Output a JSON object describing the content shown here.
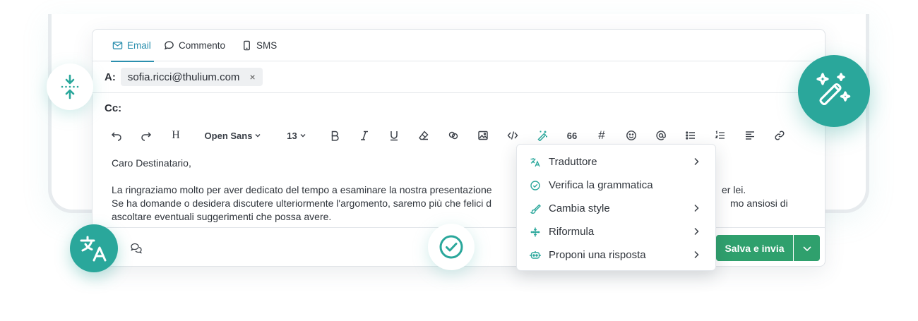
{
  "tabs": [
    {
      "label": "Email",
      "icon": "mail-icon",
      "active": true
    },
    {
      "label": "Commento",
      "icon": "comment-icon",
      "active": false
    },
    {
      "label": "SMS",
      "icon": "phone-icon",
      "active": false
    }
  ],
  "to": {
    "label": "A:",
    "recipient": "sofia.ricci@thulium.com",
    "remove": "×"
  },
  "cc": {
    "label": "Cc:"
  },
  "toolbar": {
    "font_family": "Open Sans",
    "font_size": "13",
    "heading": "H",
    "quote": "66",
    "hash": "#"
  },
  "message": {
    "greeting": "Caro Destinatario,",
    "line1_start": "La ringraziamo molto per aver dedicato del tempo a esaminare la nostra presentazione",
    "line1_end": "er lei.",
    "line2_start": "Se ha domande o desidera discutere ulteriormente l'argomento, saremo più che felici d",
    "line2_end": "mo ansiosi di",
    "line3": "ascoltare eventuali suggerimenti che possa avere."
  },
  "actions": {
    "save_send": "Salva e invia"
  },
  "ai_menu": [
    {
      "label": "Traduttore",
      "icon": "translate-icon",
      "submenu": true
    },
    {
      "label": "Verifica la grammatica",
      "icon": "check-circle-icon",
      "submenu": false
    },
    {
      "label": "Cambia style",
      "icon": "brush-icon",
      "submenu": true
    },
    {
      "label": "Riformula",
      "icon": "rephrase-icon",
      "submenu": true
    },
    {
      "label": "Proponi una risposta",
      "icon": "bot-icon",
      "submenu": true
    }
  ],
  "colors": {
    "accent": "#2aa79b",
    "tab_active": "#2b8fae",
    "primary_button": "#2fa06d"
  }
}
